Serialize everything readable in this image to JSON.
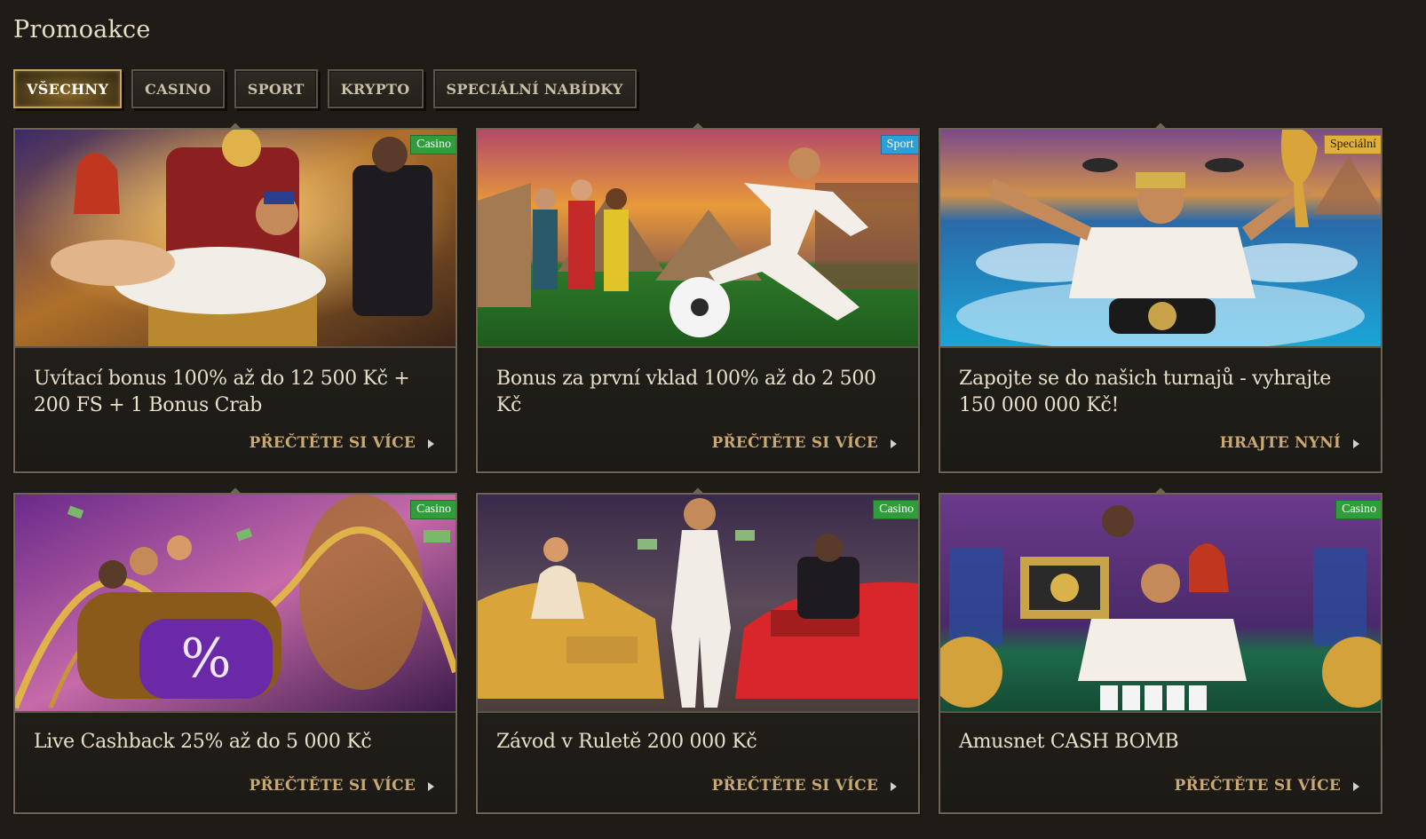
{
  "page": {
    "title": "Promoakce"
  },
  "filters": [
    {
      "label": "VŠECHNY",
      "active": true
    },
    {
      "label": "CASINO",
      "active": false
    },
    {
      "label": "SPORT",
      "active": false
    },
    {
      "label": "KRYPTO",
      "active": false
    },
    {
      "label": "SPECIÁLNÍ NABÍDKY",
      "active": false
    }
  ],
  "promos": [
    {
      "badge": "Casino",
      "title": "Uvítací bonus 100% až do 12 500 Kč + 200 FS + 1 Bonus Crab",
      "cta": "PŘEČTĚTE SI VÍCE"
    },
    {
      "badge": "Sport",
      "title": "Bonus za první vklad 100% až do 2 500 Kč",
      "cta": "PŘEČTĚTE SI VÍCE"
    },
    {
      "badge": "Speciální",
      "title": "Zapojte se do našich turnajů - vyhrajte 150 000 000 Kč!",
      "cta": "HRAJTE NYNÍ"
    },
    {
      "badge": "Casino",
      "title": "Live Cashback 25% až do 5 000 Kč",
      "cta": "PŘEČTĚTE SI VÍCE"
    },
    {
      "badge": "Casino",
      "title": "Závod v Ruletě 200 000 Kč",
      "cta": "PŘEČTĚTE SI VÍCE"
    },
    {
      "badge": "Casino",
      "title": "Amusnet CASH BOMB",
      "cta": "PŘEČTĚTE SI VÍCE"
    }
  ],
  "colors": {
    "background": "#1f1c17",
    "accent_gold": "#c9a872",
    "badge_casino": "#2f9e3a",
    "badge_sport": "#2aa0d9",
    "badge_special": "#e0b13a"
  },
  "icons": {
    "cta_arrow": "triangle-right-icon"
  }
}
